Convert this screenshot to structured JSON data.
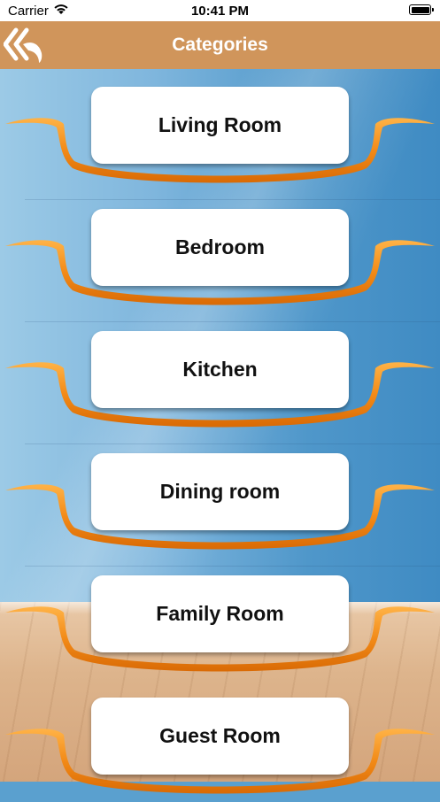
{
  "status_bar": {
    "carrier": "Carrier",
    "time": "10:41 PM"
  },
  "nav": {
    "title": "Categories",
    "back_icon": "double-chevron-back-icon"
  },
  "colors": {
    "nav_background": "#d0955b",
    "ribbon_orange": "#f08a1c",
    "card_background": "#ffffff"
  },
  "categories": [
    {
      "label": "Living Room"
    },
    {
      "label": "Bedroom"
    },
    {
      "label": "Kitchen"
    },
    {
      "label": "Dining room"
    },
    {
      "label": "Family Room"
    },
    {
      "label": "Guest Room"
    }
  ]
}
